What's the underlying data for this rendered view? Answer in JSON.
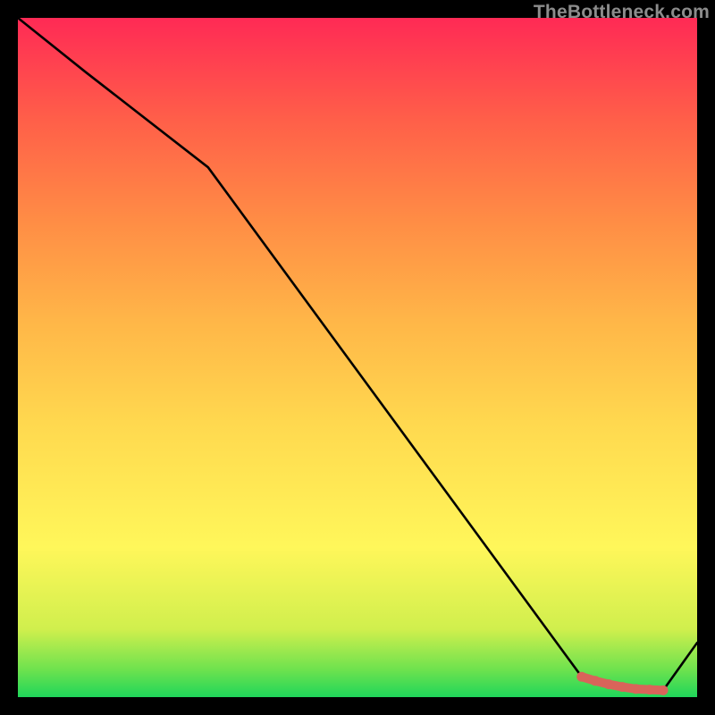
{
  "watermark": "TheBottleneck.com",
  "chart_data": {
    "type": "line",
    "title": "",
    "xlabel": "",
    "ylabel": "",
    "xlim": [
      0,
      100
    ],
    "ylim": [
      0,
      100
    ],
    "series": [
      {
        "name": "main",
        "color": "#000000",
        "x": [
          0,
          10,
          28,
          83,
          90,
          95,
          100
        ],
        "y": [
          100,
          92,
          78,
          3,
          1,
          1,
          8
        ]
      },
      {
        "name": "highlight",
        "color": "#d9645a",
        "x": [
          83,
          85,
          87,
          89,
          91,
          93,
          95
        ],
        "y": [
          3.0,
          2.4,
          1.9,
          1.5,
          1.2,
          1.1,
          1.0
        ]
      }
    ],
    "gradient_stops": [
      {
        "pos": 0.0,
        "color": "#1fd65a"
      },
      {
        "pos": 0.04,
        "color": "#6de24e"
      },
      {
        "pos": 0.1,
        "color": "#d0ef4d"
      },
      {
        "pos": 0.22,
        "color": "#fff75a"
      },
      {
        "pos": 0.4,
        "color": "#ffd94f"
      },
      {
        "pos": 0.55,
        "color": "#ffb748"
      },
      {
        "pos": 0.7,
        "color": "#ff8d45"
      },
      {
        "pos": 0.85,
        "color": "#ff5f49"
      },
      {
        "pos": 1.0,
        "color": "#ff2a55"
      }
    ]
  }
}
